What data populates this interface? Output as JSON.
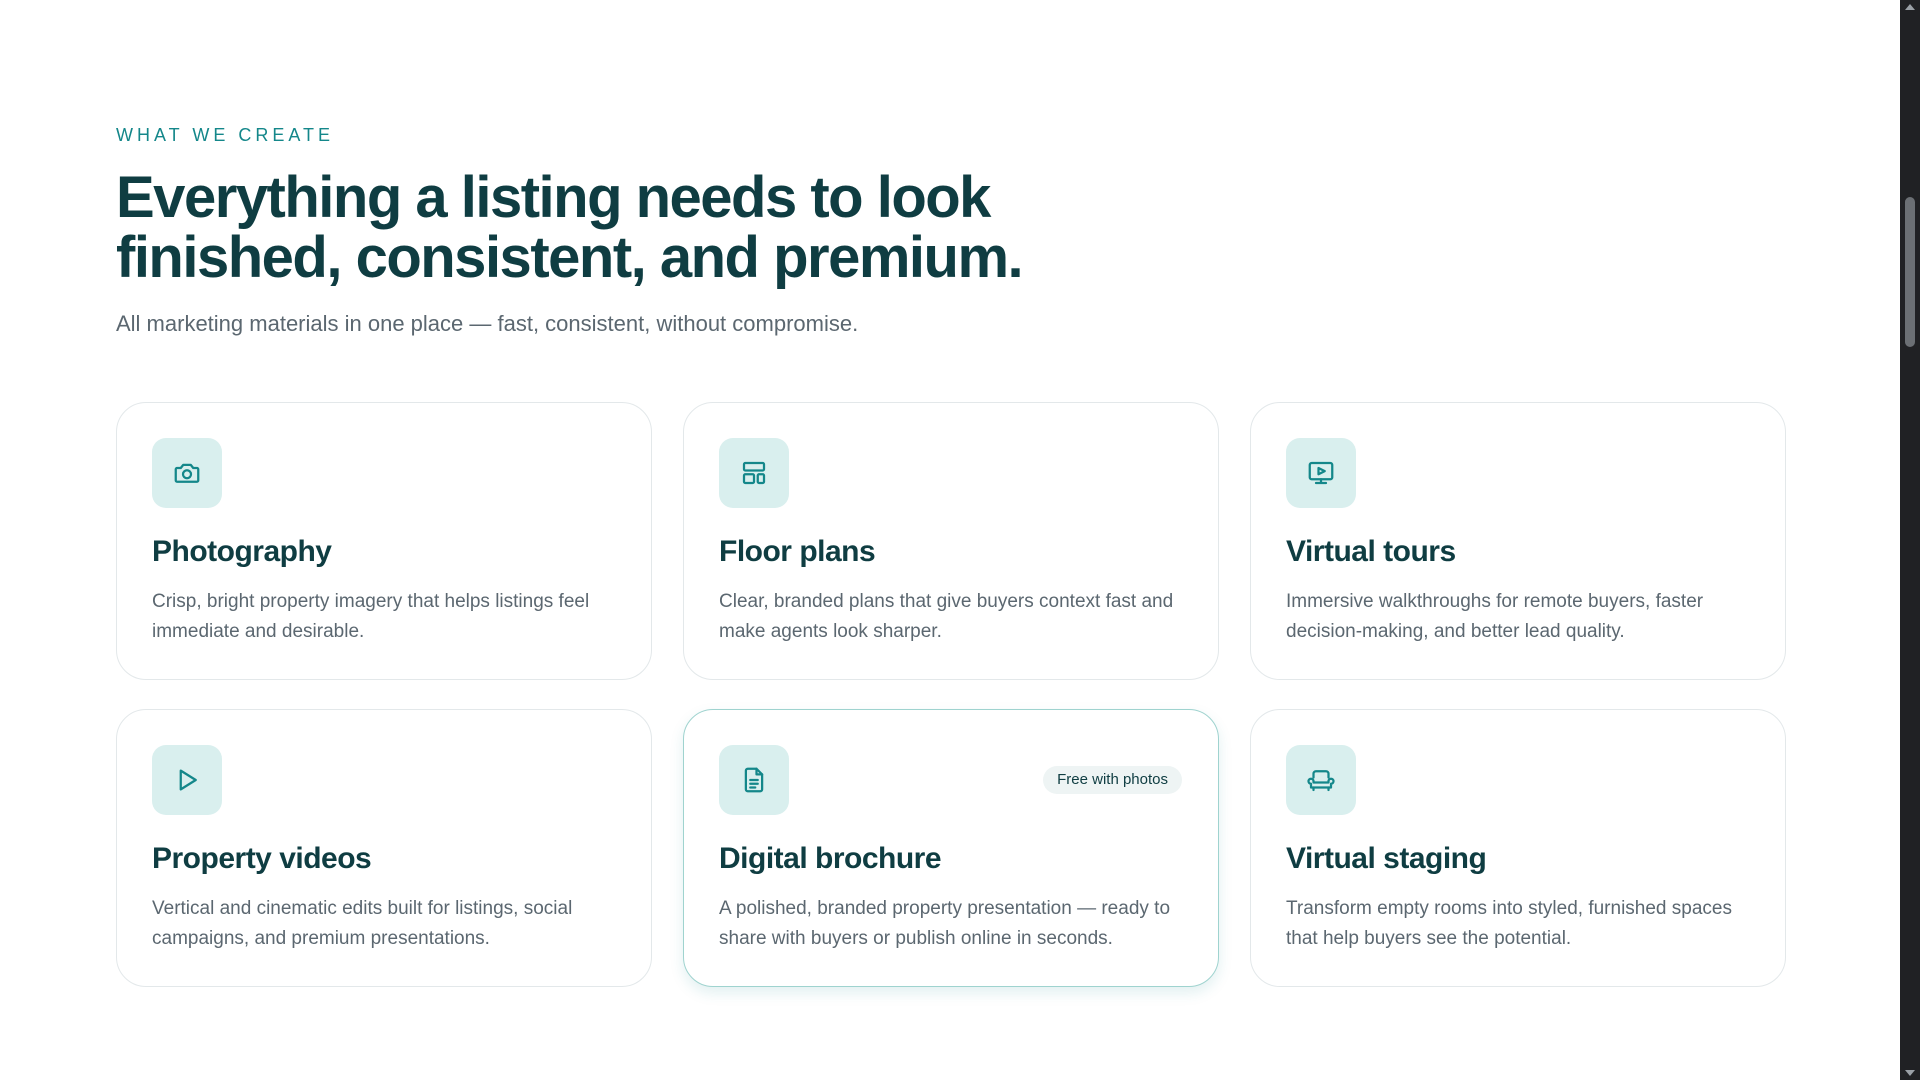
{
  "section": {
    "eyebrow": "WHAT WE CREATE",
    "headline": "Everything a listing needs to look finished, consistent, and premium.",
    "subhead": "All marketing materials in one place — fast, consistent, without compromise."
  },
  "cards": [
    {
      "icon": "camera-icon",
      "title": "Photography",
      "desc": "Crisp, bright property imagery that helps listings feel immediate and desirable."
    },
    {
      "icon": "floor-plan-icon",
      "title": "Floor plans",
      "desc": "Clear, branded plans that give buyers context fast and make agents look sharper."
    },
    {
      "icon": "virtual-tour-icon",
      "title": "Virtual tours",
      "desc": "Immersive walkthroughs for remote buyers, faster decision-making, and better lead quality."
    },
    {
      "icon": "play-icon",
      "title": "Property videos",
      "desc": "Vertical and cinematic edits built for listings, social campaigns, and premium presentations."
    },
    {
      "icon": "document-icon",
      "title": "Digital brochure",
      "desc": "A polished, branded property presentation — ready to share with buyers or publish online in seconds.",
      "badge": "Free with photos"
    },
    {
      "icon": "sofa-icon",
      "title": "Virtual staging",
      "desc": "Transform empty rooms into styled, furnished spaces that help buyers see the potential."
    }
  ],
  "colors": {
    "accent": "#14878a",
    "heading": "#0f3d42",
    "body_text": "#5b6770",
    "icon_bg": "#d9efee"
  }
}
